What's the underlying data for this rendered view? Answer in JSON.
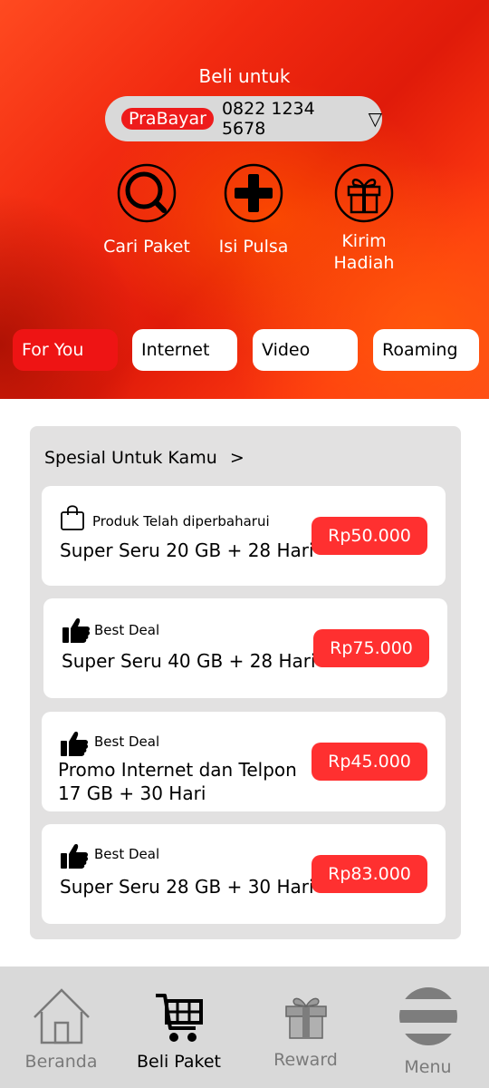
{
  "header": {
    "buy_for_label": "Beli untuk",
    "account_type_badge": "PraBayar",
    "phone_number": "0822 1234 5678",
    "dropdown_icon": "chevron-down-icon"
  },
  "quick_actions": [
    {
      "label": "Cari Paket",
      "icon": "search-icon"
    },
    {
      "label": "Isi Pulsa",
      "icon": "plus-icon"
    },
    {
      "label_line1": "Kirim",
      "label_line2": "Hadiah",
      "icon": "gift-icon"
    }
  ],
  "category_tabs": [
    {
      "label": "For You",
      "active": true
    },
    {
      "label": "Internet",
      "active": false
    },
    {
      "label": "Video",
      "active": false
    },
    {
      "label": "Roaming",
      "active": false
    }
  ],
  "special_section": {
    "title": "Spesial Untuk Kamu",
    "arrow": ">",
    "packages": [
      {
        "tag": "Produk Telah diperbaharui",
        "tag_icon": "shopping-bag-icon",
        "name_line1": "Super Seru 20 GB + 28 Hari",
        "name_line2": "",
        "price": "Rp50.000"
      },
      {
        "tag": "Best Deal",
        "tag_icon": "thumbs-up-icon",
        "name_line1": "Super Seru 40 GB + 28 Hari",
        "name_line2": "",
        "price": "Rp75.000"
      },
      {
        "tag": "Best Deal",
        "tag_icon": "thumbs-up-icon",
        "name_line1": "Promo Internet dan Telpon",
        "name_line2": "17 GB + 30 Hari",
        "price": "Rp45.000"
      },
      {
        "tag": "Best Deal",
        "tag_icon": "thumbs-up-icon",
        "name_line1": "Super Seru 28 GB + 30 Hari",
        "name_line2": "",
        "price": "Rp83.000"
      }
    ]
  },
  "bottom_nav": [
    {
      "label": "Beranda",
      "icon": "home-icon",
      "active": false
    },
    {
      "label": "Beli Paket",
      "icon": "cart-icon",
      "active": true
    },
    {
      "label": "Reward",
      "icon": "gift-icon",
      "active": false
    },
    {
      "label": "Menu",
      "icon": "menu-icon",
      "active": false
    }
  ],
  "colors": {
    "accent_red": "#ee1414",
    "price_red": "#ff3030",
    "nav_background": "#d9d9d9",
    "section_background": "#e2e1e1"
  }
}
